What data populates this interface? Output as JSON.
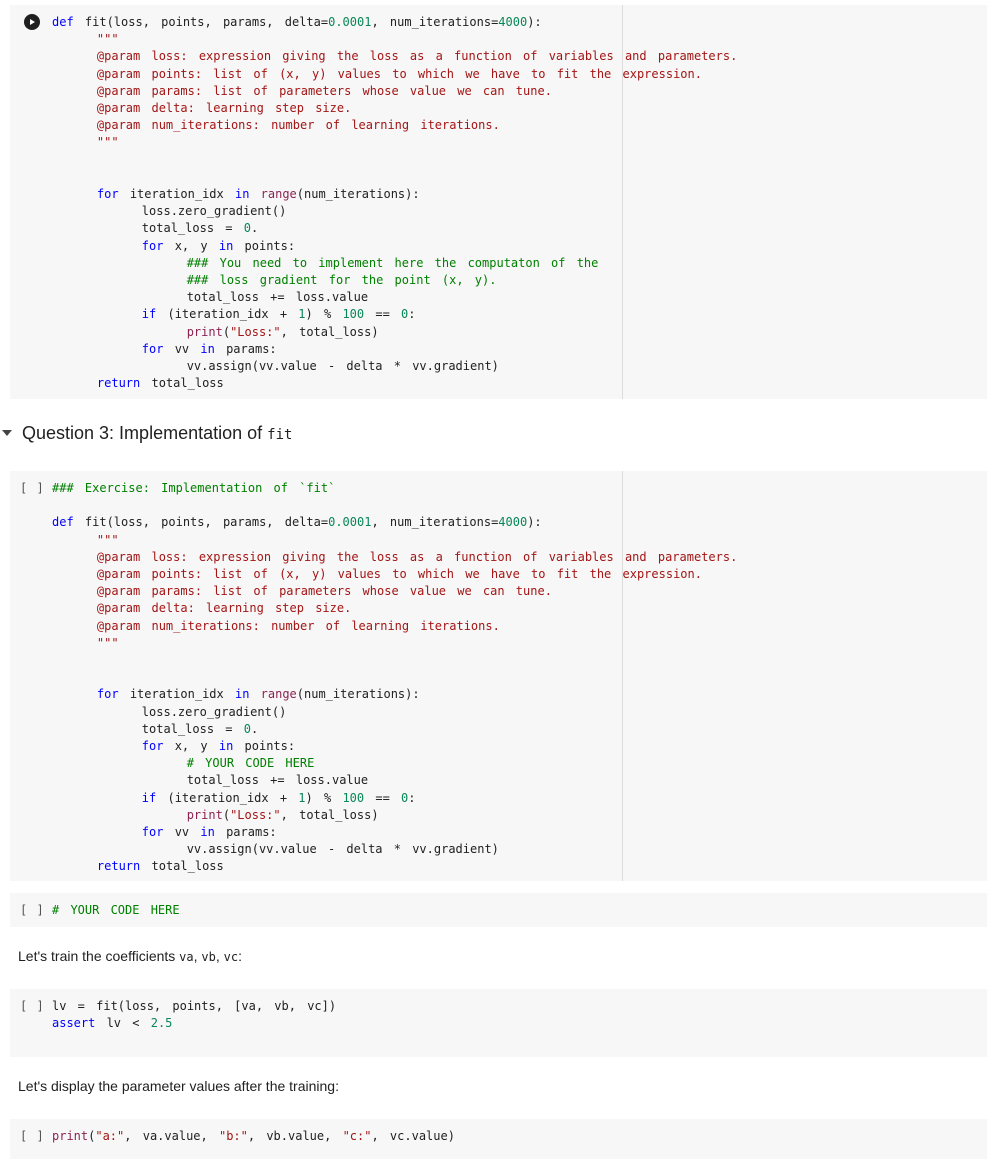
{
  "cells": {
    "cell1_lines": [
      "def fit(loss, points, params, delta=0.0001, num_iterations=4000):",
      "    \"\"\"",
      "    @param loss: expression giving the loss as a function of variables and parameters.",
      "    @param points: list of (x, y) values to which we have to fit the expression.",
      "    @param params: list of parameters whose value we can tune.",
      "    @param delta: learning step size.",
      "    @param num_iterations: number of learning iterations.",
      "    \"\"\"",
      "",
      "",
      "    for iteration_idx in range(num_iterations):",
      "        loss.zero_gradient()",
      "        total_loss = 0.",
      "        for x, y in points:",
      "            ### You need to implement here the computaton of the",
      "            ### loss gradient for the point (x, y).",
      "            total_loss += loss.value",
      "        if (iteration_idx + 1) % 100 == 0:",
      "            print(\"Loss:\", total_loss)",
      "        for vv in params:",
      "            vv.assign(vv.value - delta * vv.gradient)",
      "    return total_loss"
    ],
    "cell2_lines": [
      "### Exercise: Implementation of `fit`",
      "",
      "def fit(loss, points, params, delta=0.0001, num_iterations=4000):",
      "    \"\"\"",
      "    @param loss: expression giving the loss as a function of variables and parameters.",
      "    @param points: list of (x, y) values to which we have to fit the expression.",
      "    @param params: list of parameters whose value we can tune.",
      "    @param delta: learning step size.",
      "    @param num_iterations: number of learning iterations.",
      "    \"\"\"",
      "",
      "",
      "    for iteration_idx in range(num_iterations):",
      "        loss.zero_gradient()",
      "        total_loss = 0.",
      "        for x, y in points:",
      "            # YOUR CODE HERE",
      "            total_loss += loss.value",
      "        if (iteration_idx + 1) % 100 == 0:",
      "            print(\"Loss:\", total_loss)",
      "        for vv in params:",
      "            vv.assign(vv.value - delta * vv.gradient)",
      "    return total_loss"
    ],
    "cell3_lines": [
      "# YOUR CODE HERE"
    ],
    "cell4_lines": [
      "lv = fit(loss, points, [va, vb, vc])",
      "assert lv < 2.5"
    ],
    "cell5_lines": [
      "print(\"a:\", va.value, \"b:\", vb.value, \"c:\", vc.value)"
    ]
  },
  "bracket": "[ ]",
  "section": {
    "title_text": "Question 3: Implementation of ",
    "title_code": "fit"
  },
  "md1": {
    "text": "Let's train the coefficients ",
    "codes": [
      "va",
      "vb",
      "vc"
    ],
    "sep": ", ",
    "end": ":"
  },
  "md2": {
    "text": "Let's display the parameter values after the training:"
  }
}
